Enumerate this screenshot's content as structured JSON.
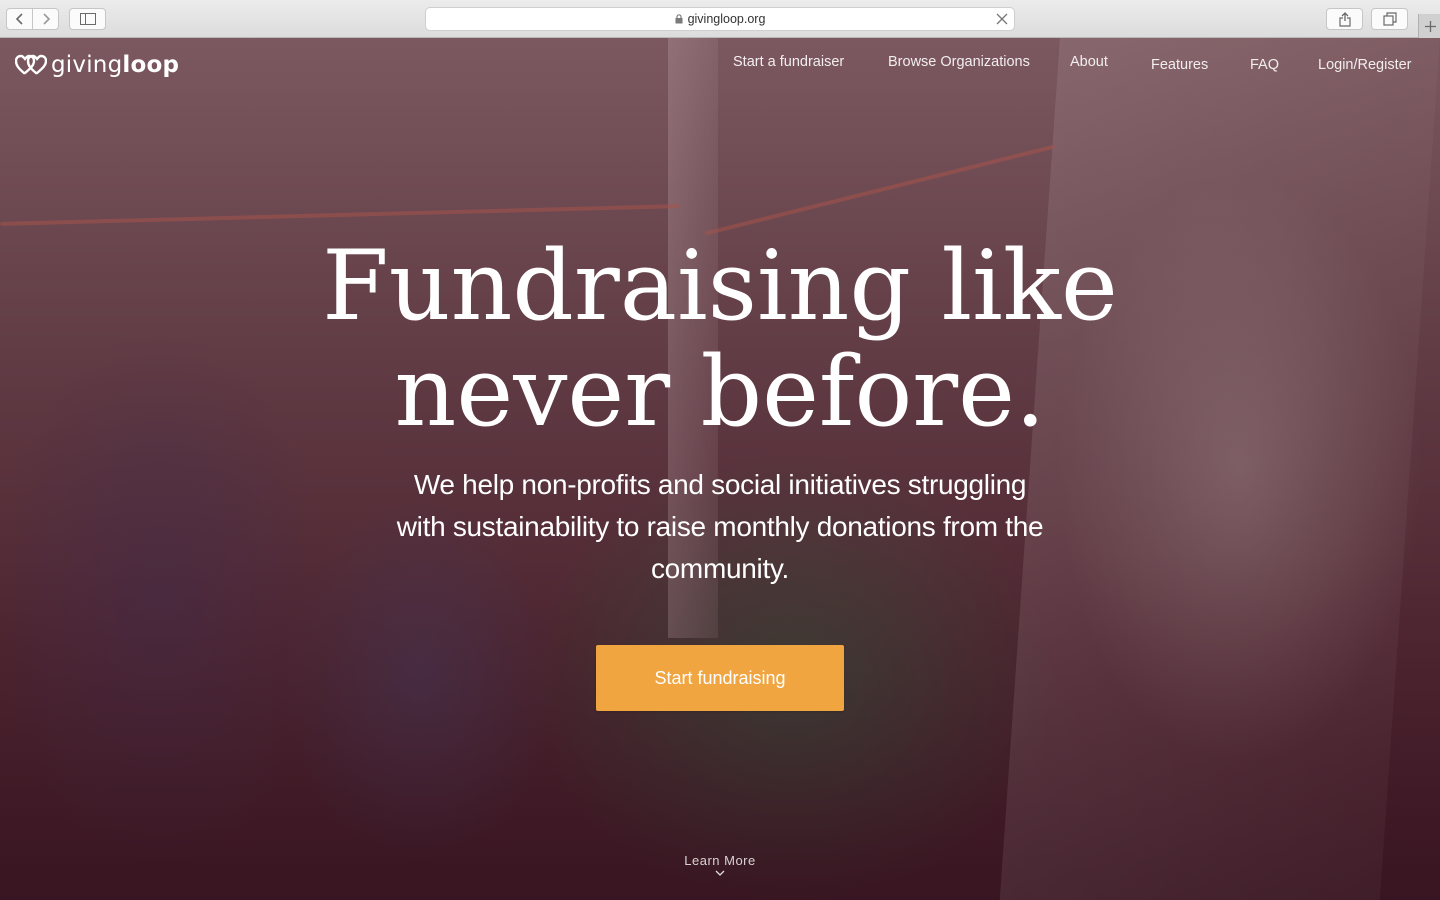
{
  "browser": {
    "url": "givingloop.org"
  },
  "nav": {
    "logo_light": "giving",
    "logo_bold": "loop",
    "items": [
      {
        "label": "Start a fundraiser"
      },
      {
        "label": "Browse Organizations"
      },
      {
        "label": "About"
      },
      {
        "label": "Features"
      },
      {
        "label": "FAQ"
      },
      {
        "label": "Login/Register"
      }
    ]
  },
  "hero": {
    "headline_line1": "Fundraising like",
    "headline_line2": "never before.",
    "subhead": "We help non-profits and social initiatives struggling with sustainability to raise monthly donations from the community.",
    "cta_label": "Start fundraising",
    "learn_more": "Learn More"
  },
  "colors": {
    "cta": "#f0a540",
    "overlay": "#5a1530"
  }
}
